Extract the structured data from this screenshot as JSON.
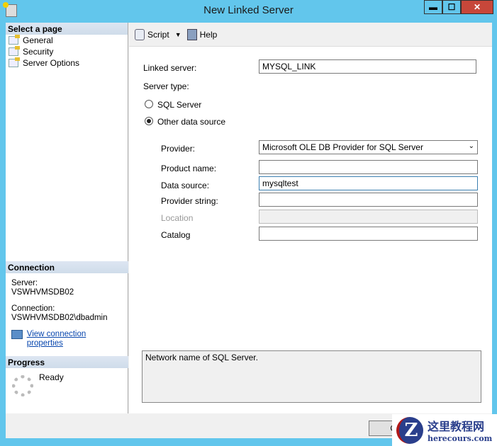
{
  "window": {
    "title": "New Linked Server",
    "min": "▬",
    "max": "☐",
    "close": "✕"
  },
  "sidebar": {
    "header": "Select a page",
    "items": [
      {
        "label": "General"
      },
      {
        "label": "Security"
      },
      {
        "label": "Server Options"
      }
    ]
  },
  "connection": {
    "header": "Connection",
    "server_label": "Server:",
    "server": "VSWHVMSDB02",
    "connection_label": "Connection:",
    "connection": "VSWHVMSDB02\\dbadmin",
    "view_link": "View connection properties"
  },
  "progress": {
    "header": "Progress",
    "status": "Ready"
  },
  "toolbar": {
    "script": "Script",
    "help": "Help"
  },
  "form": {
    "linked_server_label": "Linked server:",
    "linked_server": "MYSQL_LINK",
    "server_type_label": "Server type:",
    "sql_server": "SQL Server",
    "other": "Other data source",
    "provider_label": "Provider:",
    "provider": "Microsoft OLE DB Provider for SQL Server",
    "product_label": "Product name:",
    "product": "",
    "data_source_label": "Data source:",
    "data_source": "mysqltest",
    "provider_string_label": "Provider string:",
    "provider_string": "",
    "location_label": "Location",
    "location": "",
    "catalog_label": "Catalog",
    "catalog": ""
  },
  "description": "Network name of SQL Server.",
  "buttons": {
    "ok": "O"
  },
  "watermark": {
    "title": "这里教程网",
    "url": "herecours.com"
  }
}
